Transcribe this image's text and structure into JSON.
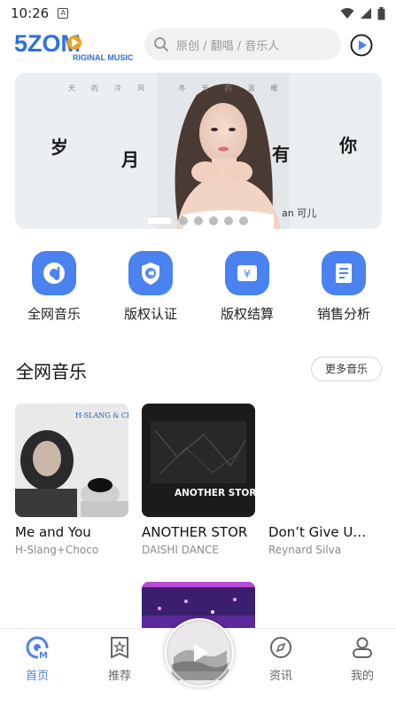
{
  "status_bar": {
    "time": "10:26",
    "a_icon": "A"
  },
  "header": {
    "logo_text": "5ZOM",
    "logo_sub": "RIGINAL MUSIC",
    "search_placeholder": "原创 / 翻唱 / 音乐人"
  },
  "banner": {
    "chars": [
      "岁",
      "月",
      "有",
      "你"
    ],
    "small_text": "天的冷风 冬天的温暖",
    "artist": "an 可儿",
    "slide_count": 6,
    "active_slide": 0
  },
  "features": [
    {
      "label": "全网音乐",
      "icon": "music-disc-icon"
    },
    {
      "label": "版权认证",
      "icon": "copyright-shield-icon"
    },
    {
      "label": "版权结算",
      "icon": "yuan-wallet-icon"
    },
    {
      "label": "销售分析",
      "icon": "analysis-doc-icon"
    }
  ],
  "section": {
    "title": "全网音乐",
    "more_label": "更多音乐"
  },
  "songs": [
    {
      "title": "Me and You",
      "artist": "H-Slang+Choco",
      "cover_text": "H-SLANG & CHOCO"
    },
    {
      "title": "ANOTHER STOR",
      "artist": "DAISHI DANCE",
      "cover_text": "ANOTHER STORY"
    },
    {
      "title": "Don’t Give U…",
      "artist": "Reynard Silva"
    }
  ],
  "bottom_nav": [
    {
      "label": "首页",
      "icon": "home-icon",
      "active": true
    },
    {
      "label": "推荐",
      "icon": "star-box-icon",
      "active": false
    },
    {
      "label": "资讯",
      "icon": "compass-icon",
      "active": false
    },
    {
      "label": "我的",
      "icon": "user-icon",
      "active": false
    }
  ],
  "colors": {
    "accent": "#4a82ef",
    "logo": "#2f6fe0"
  }
}
